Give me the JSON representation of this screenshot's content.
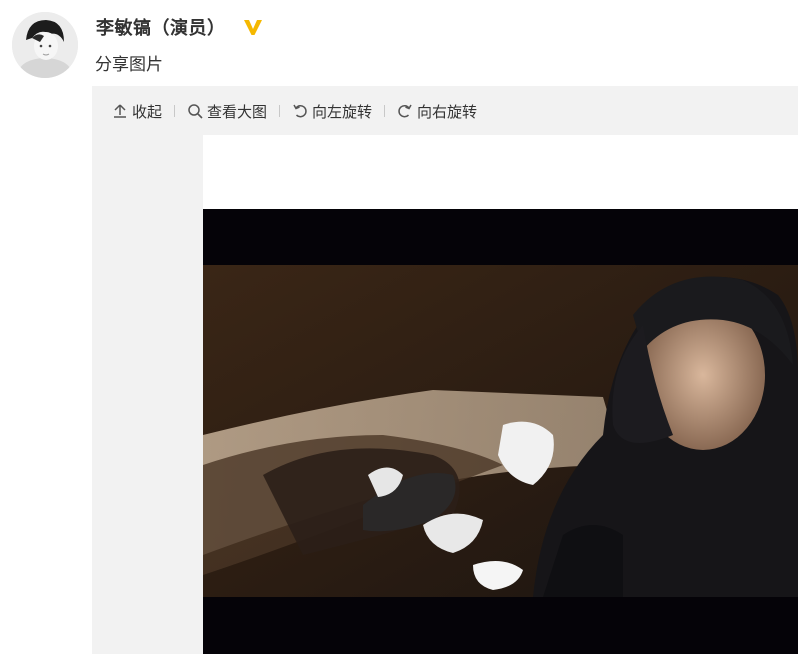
{
  "post": {
    "author": "李敏镐（演员）",
    "verified_icon": "verified-v-icon",
    "text": "分享图片"
  },
  "toolbar": {
    "collapse": {
      "label": "收起",
      "icon": "arrow-up-icon"
    },
    "view_large": {
      "label": "查看大图",
      "icon": "magnifier-icon"
    },
    "rotate_left": {
      "label": "向左旋转",
      "icon": "rotate-left-icon"
    },
    "rotate_right": {
      "label": "向右旋转",
      "icon": "rotate-right-icon"
    }
  },
  "colors": {
    "verified_badge": "#f5b800",
    "text": "#333333",
    "panel_bg": "#f2f2f2",
    "photo_letterbox": "#050308"
  }
}
